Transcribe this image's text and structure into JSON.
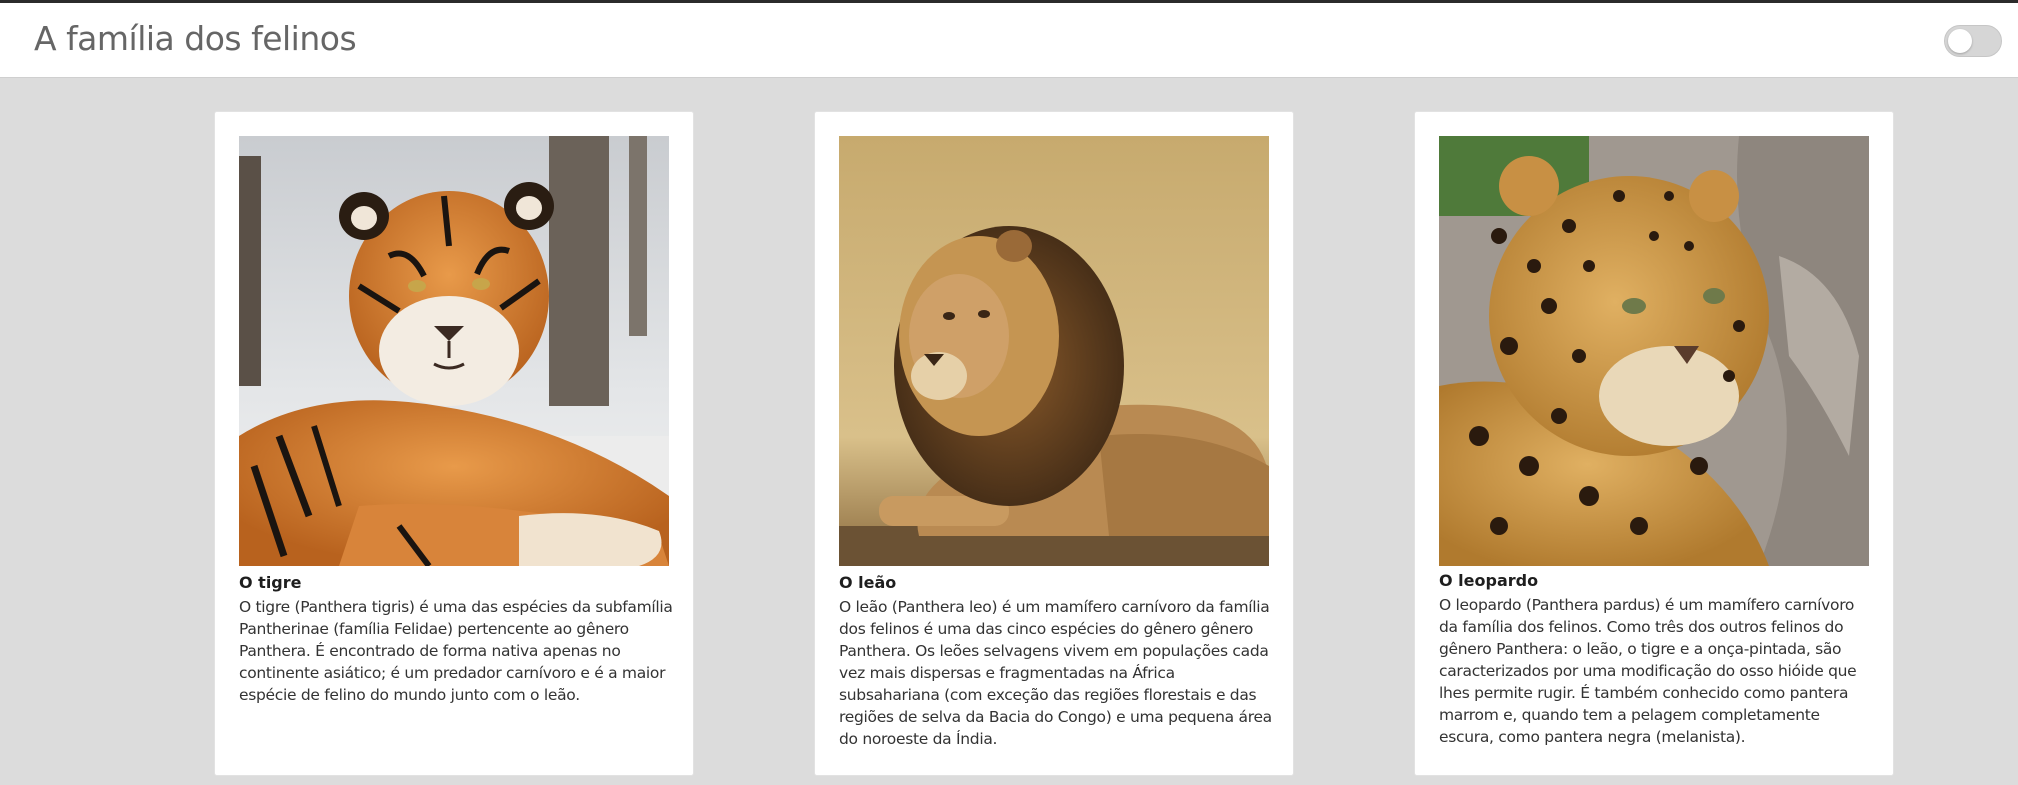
{
  "header": {
    "title": "A família dos felinos",
    "theme_toggle_state": "off"
  },
  "cards": [
    {
      "image_alt": "tiger-photo",
      "title": "O tigre",
      "text": "O tigre (Panthera tigris) é uma das espécies da subfamília Pantherinae (família Felidae) pertencente ao gênero Panthera. É encontrado de forma nativa apenas no continente asiático; é um predador carnívoro e é a maior espécie de felino do mundo junto com o leão."
    },
    {
      "image_alt": "lion-photo",
      "title": "O leão",
      "text": "O leão (Panthera leo) é um mamífero carnívoro da família dos felinos é uma das cinco espécies do gênero gênero Panthera. Os leões selvagens vivem em populações cada vez mais dispersas e fragmentadas na África subsahariana (com exceção das regiões florestais e das regiões de selva da Bacia do Congo) e uma pequena área do noroeste da Índia."
    },
    {
      "image_alt": "leopard-photo",
      "title": "O leopardo",
      "text": "O leopardo (Panthera pardus) é um mamífero carnívoro da família dos felinos. Como três dos outros felinos do gênero Panthera: o leão, o tigre e a onça-pintada, são caracterizados por uma modificação do osso hióide que lhes permite rugir. É também conhecido como pantera marrom e, quando tem a pelagem completamente escura, como pantera negra (melanista)."
    }
  ]
}
